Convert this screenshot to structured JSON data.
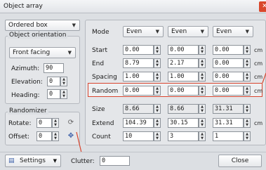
{
  "window": {
    "title": "Object array",
    "close_glyph": "✕"
  },
  "left": {
    "mode_select": "Ordered box",
    "orientation": {
      "title": "Object orientation",
      "facing_select": "Front facing",
      "azimuth_label": "Azimuth:",
      "azimuth_value": "90",
      "elevation_label": "Elevation:",
      "elevation_value": "0",
      "heading_label": "Heading:",
      "heading_value": "0"
    },
    "randomizer": {
      "title": "Randomizer",
      "rotate_label": "Rotate:",
      "rotate_value": "0",
      "offset_label": "Offset:",
      "offset_value": "0"
    }
  },
  "grid": {
    "mode_label": "Mode",
    "modes": [
      "Even",
      "Even",
      "Even"
    ],
    "unit": "cm",
    "rows": [
      {
        "label": "Start",
        "values": [
          "0.00",
          "0.00",
          "0.00"
        ],
        "readonly": false
      },
      {
        "label": "End",
        "values": [
          "8.79",
          "2.17",
          "0.00"
        ],
        "readonly": false
      },
      {
        "label": "Spacing",
        "values": [
          "1.00",
          "1.00",
          "0.00"
        ],
        "readonly": false
      },
      {
        "label": "Random",
        "values": [
          "0.00",
          "0.00",
          "0.00"
        ],
        "readonly": false
      },
      {
        "label": "Size",
        "values": [
          "8.66",
          "8.66",
          "31.31"
        ],
        "readonly": true
      },
      {
        "label": "Extend",
        "values": [
          "104.39",
          "30.15",
          "31.31"
        ],
        "readonly": false
      },
      {
        "label": "Count",
        "values": [
          "10",
          "3",
          "1"
        ],
        "readonly": false
      }
    ]
  },
  "bottom": {
    "settings_label": "Settings",
    "clutter_label": "Clutter:",
    "clutter_value": "0",
    "close_label": "Close"
  },
  "icons": {
    "dropdown": "chevron-down-icon",
    "spin": "spin-arrows-icon",
    "rotate": "rotate-icon",
    "offset": "offset-icon",
    "settings": "settings-icon"
  },
  "colors": {
    "highlight": "#d9452e",
    "close": "#d9472b"
  }
}
